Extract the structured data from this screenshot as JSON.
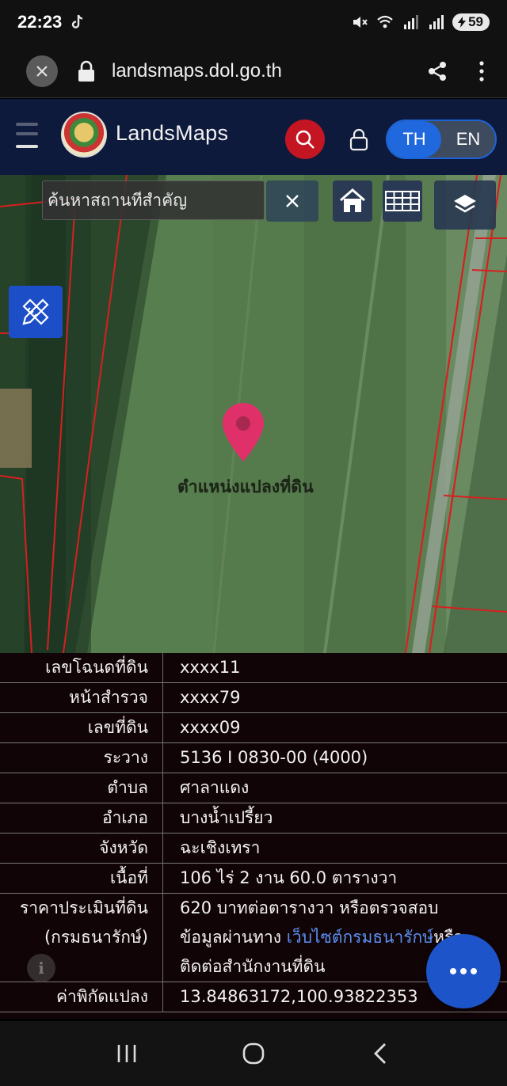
{
  "status_bar": {
    "time": "22:23",
    "battery": "59",
    "icons": [
      "tiktok-icon",
      "mute-icon",
      "wifi-icon",
      "signal-icon",
      "signal-icon",
      "battery-icon"
    ]
  },
  "browser": {
    "url": "landsmaps.dol.go.th"
  },
  "header": {
    "brand": "LandsMaps",
    "lang_th": "TH",
    "lang_en": "EN",
    "active_lang": "TH"
  },
  "map": {
    "search_placeholder": "ค้นหาสถานที่สำคัญ",
    "pin_label": "ตำแหน่งแปลงที่ดิน"
  },
  "parcel_info": {
    "rows": [
      {
        "label": "เลขโฉนดที่ดิน",
        "value": "xxxx11"
      },
      {
        "label": "หน้าสำรวจ",
        "value": "xxxx79"
      },
      {
        "label": "เลขที่ดิน",
        "value": "xxxx09"
      },
      {
        "label": "ระวาง",
        "value": "5136 I 0830-00 (4000)"
      },
      {
        "label": "ตำบล",
        "value": "ศาลาแดง"
      },
      {
        "label": "อำเภอ",
        "value": "บางน้ำเปรี้ยว"
      },
      {
        "label": "จังหวัด",
        "value": "ฉะเชิงเทรา"
      },
      {
        "label": "เนื้อที่",
        "value": "106 ไร่ 2 งาน 60.0 ตารางวา"
      }
    ],
    "appraisal": {
      "label_1": "ราคาประเมินที่ดิน",
      "label_2": "(กรมธนารักษ์)",
      "value_1": "620 บาทต่อตารางวา หรือตรวจสอบ",
      "value_2_prefix": "ข้อมูลผ่านทาง",
      "value_2_link": "เว็บไซต์กรมธนารักษ์",
      "value_2_suffix": "หรือ",
      "value_3": "ติดต่อสำนักงานที่ดิน"
    },
    "coordinates": {
      "label": "ค่าพิกัดแปลง",
      "value": "13.84863172,100.93822353"
    }
  }
}
